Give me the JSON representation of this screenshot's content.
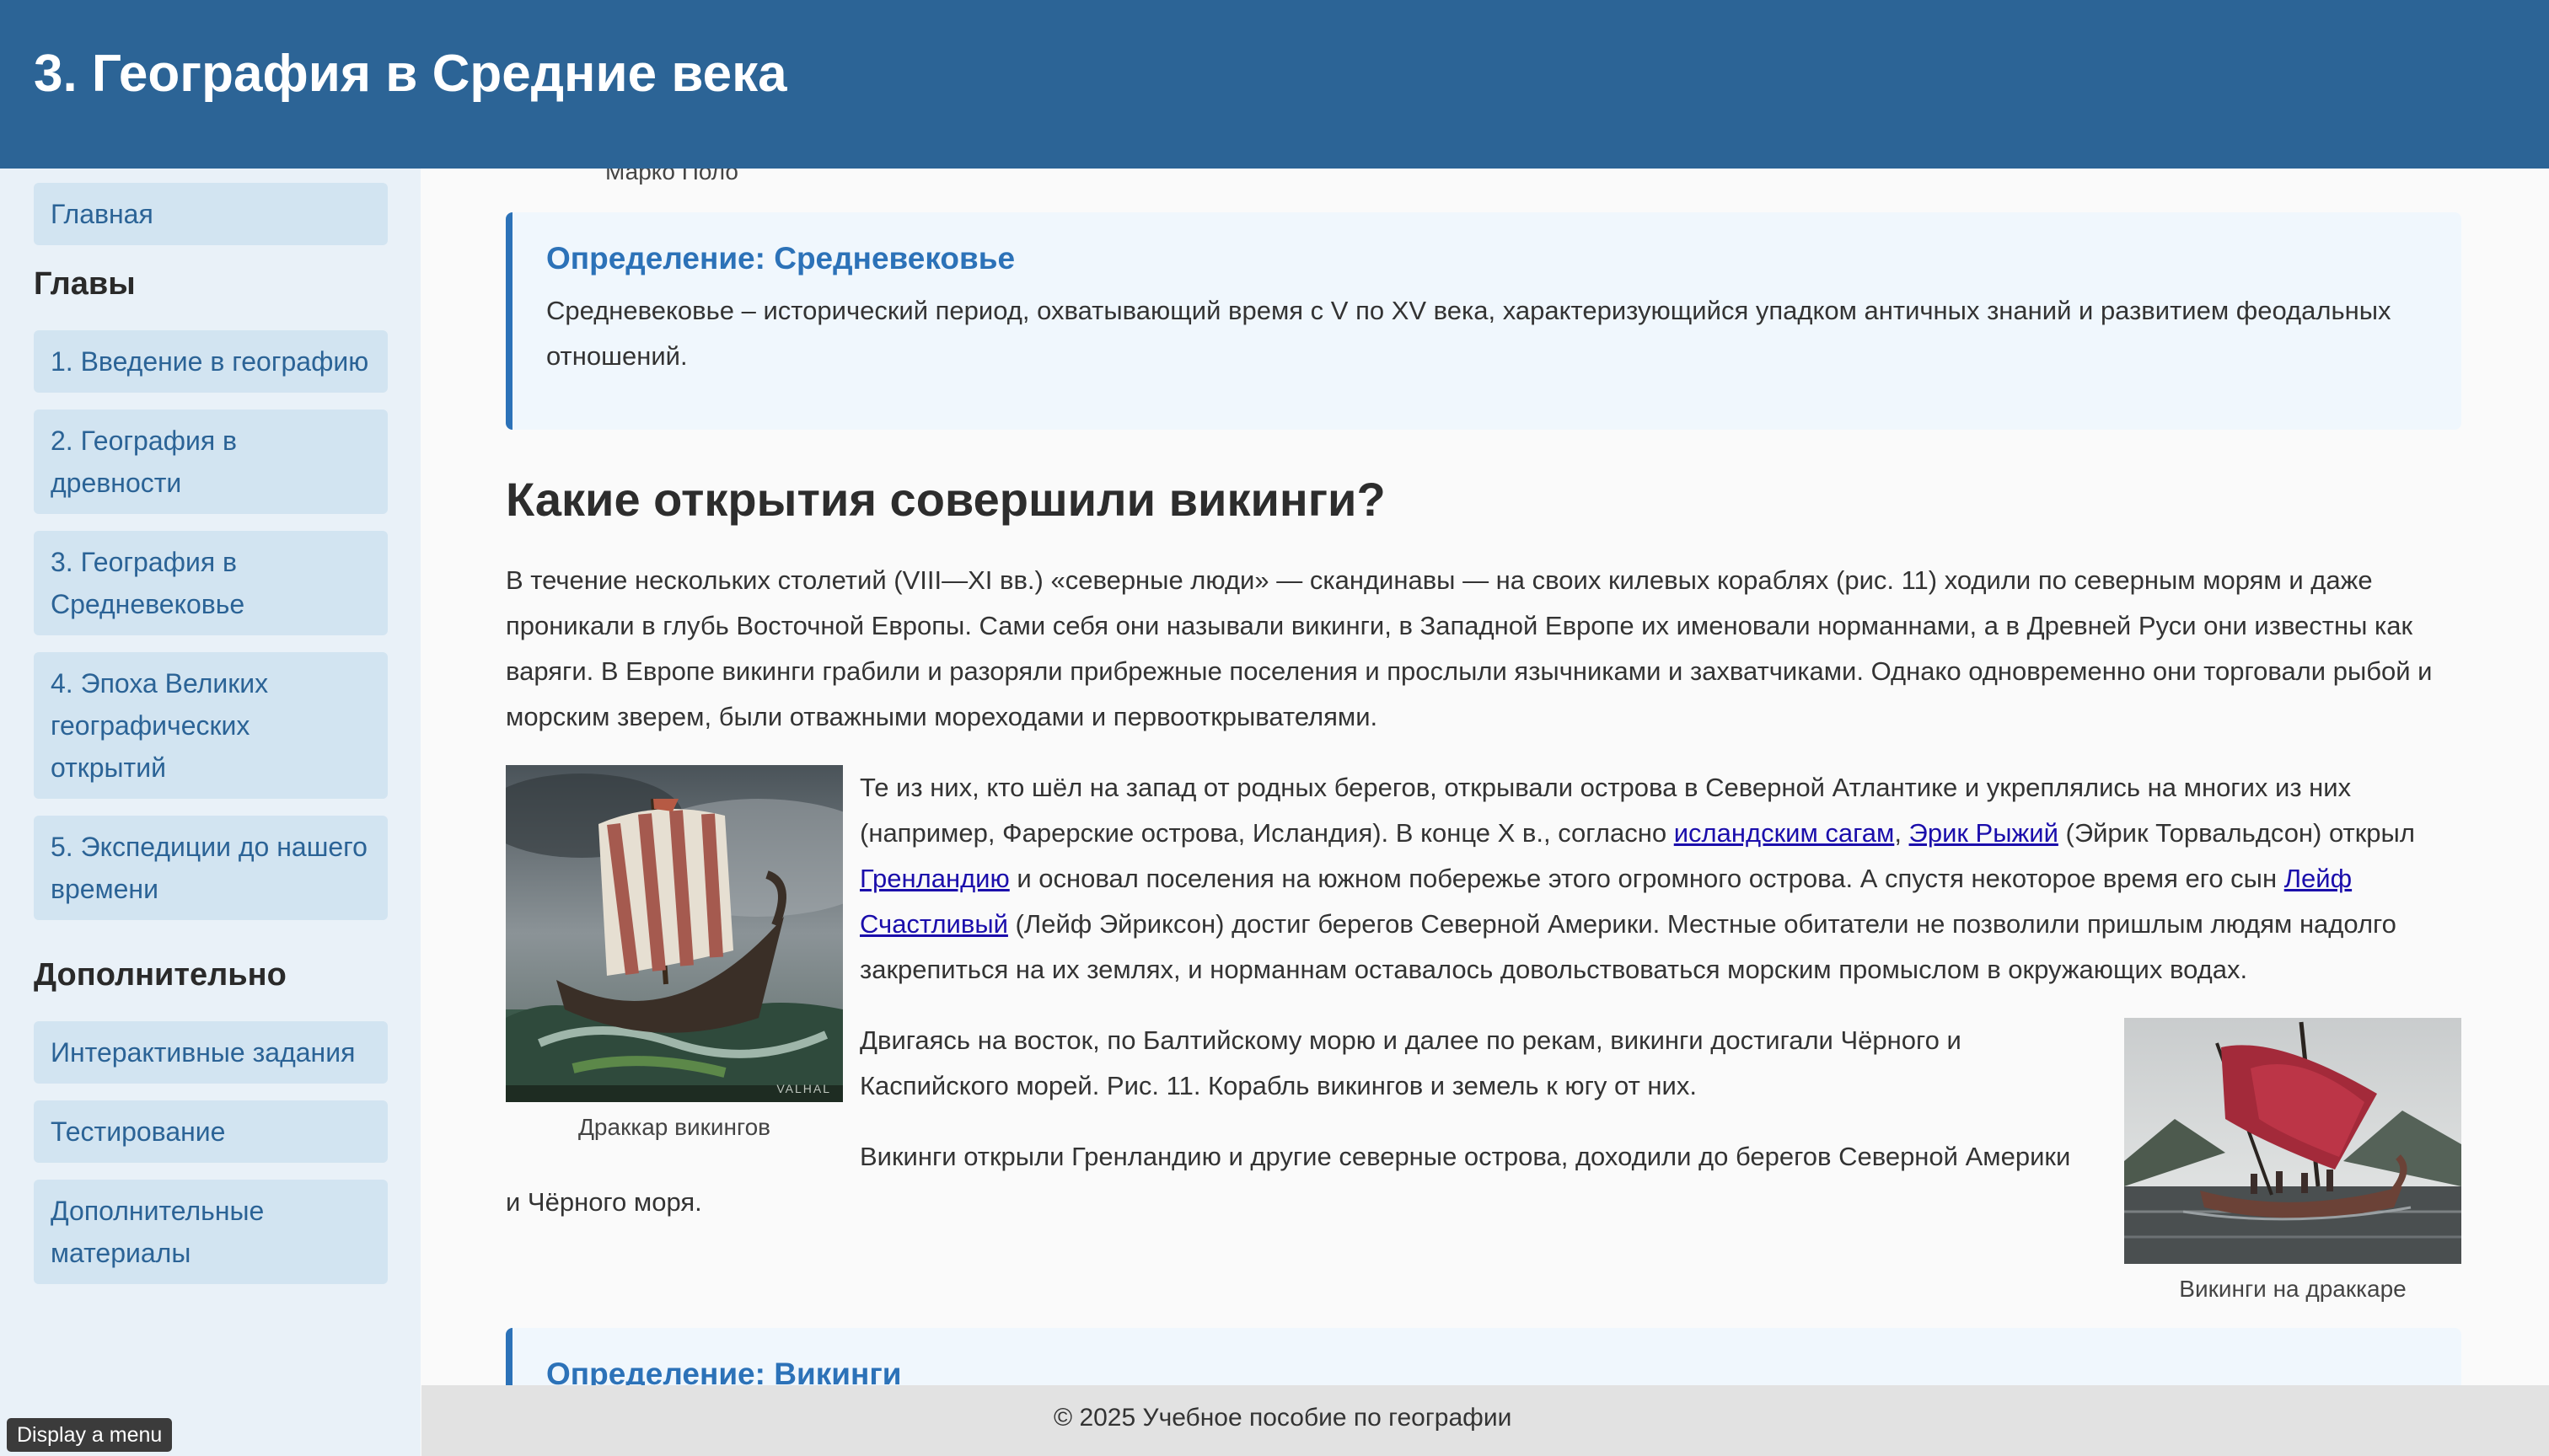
{
  "header": {
    "title": "3. География в Средние века"
  },
  "sidebar": {
    "home": "Главная",
    "chapters_heading": "Главы",
    "chapters": [
      "1. Введение в географию",
      "2. География в древности",
      "3. География в Средневековье",
      "4. Эпоха Великих географических открытий",
      "5. Экспедиции до нашего времени"
    ],
    "extra_heading": "Дополнительно",
    "extra": [
      "Интерактивные задания",
      "Тестирование",
      "Дополнительные материалы"
    ]
  },
  "main": {
    "top_caption": "Марко Поло",
    "definition1": {
      "title": "Определение: Средневековье",
      "text": "Средневековье – исторический период, охватывающий время с V по XV века, характеризующийся упадком античных знаний и развитием феодальных отношений."
    },
    "section_title": "Какие открытия совершили викинги?",
    "para1": "В течение нескольких столетий (VIII—XI вв.) «северные люди» — скандинавы — на своих килевых кораблях (рис. 11) ходили по северным морям и даже проникали в глубь Восточной Европы. Сами себя они называли викинги, в Западной Европе их именовали норманнами, а в Древней Руси они известны как варяги. В Европе викинги грабили и разоряли прибрежные поселения и прослыли язычниками и захватчиками. Однако одновременно они торговали рыбой и морским зверем, были отважными мореходами и первооткрывателями.",
    "para2": {
      "t1": "Те из них, кто шёл на запад от родных берегов, открывали острова в Северной Атлантике и укреплялись на многих из них (например, Фарерские острова, Исландия). В конце X в., согласно ",
      "link1": "исландским сагам",
      "t2": ", ",
      "link2": "Эрик Рыжий",
      "t3": " (Эйрик Торвальдсон) открыл ",
      "link3": "Гренландию",
      "t4": " и основал поселения на южном побережье этого огромного острова. А спустя некоторое время его сын ",
      "link4": "Лейф Счастливый",
      "t5": " (Лейф Эйриксон) достиг берегов Северной Америки. Местные обитатели не позволили пришлым людям надолго закрепиться на их землях, и норманнам оставалось довольствоваться морским промыслом в окружающих водах."
    },
    "para3": "Двигаясь на восток, по Балтийскому морю и далее по рекам, викинги достигали Чёрного и Каспийского морей. Рис. 11. Корабль викингов и земель к югу от них.",
    "para4": "Викинги открыли Гренландию и другие северные острова, доходили до берегов Северной Америки и Чёрного моря.",
    "image1_caption": "Драккар викингов",
    "image1_watermark": "VALHAL",
    "image2_caption": "Викинги на драккаре",
    "definition2": {
      "title": "Определение: Викинги"
    }
  },
  "footer": {
    "text": "© 2025 Учебное пособие по географии"
  },
  "tooltip": {
    "text": "Display a menu"
  }
}
